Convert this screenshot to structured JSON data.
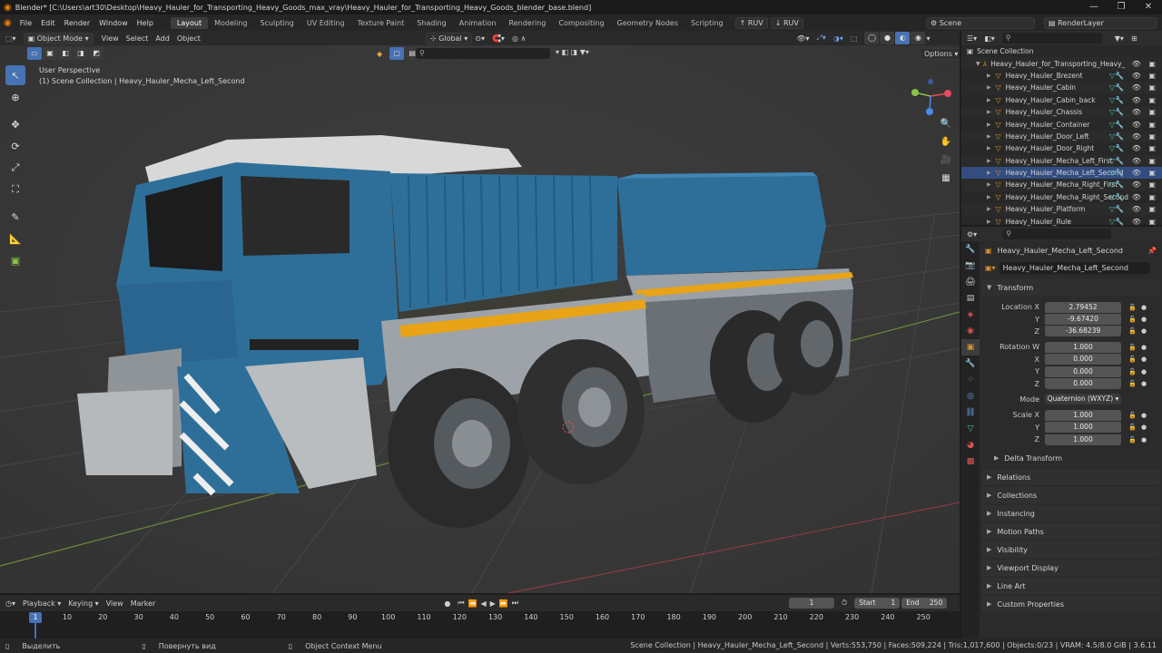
{
  "window": {
    "title": "Blender* [C:\\Users\\art30\\Desktop\\Heavy_Hauler_for_Transporting_Heavy_Goods_max_vray\\Heavy_Hauler_for_Transporting_Heavy_Goods_blender_base.blend]",
    "minimize": "—",
    "maximize": "❐",
    "close": "✕"
  },
  "menu": {
    "items": [
      "File",
      "Edit",
      "Render",
      "Window",
      "Help"
    ],
    "workspaces": [
      "Layout",
      "Modeling",
      "Sculpting",
      "UV Editing",
      "Texture Paint",
      "Shading",
      "Animation",
      "Rendering",
      "Compositing",
      "Geometry Nodes",
      "Scripting"
    ],
    "active_workspace": "Layout",
    "ruv1": "RUV",
    "ruv2": "RUV",
    "scene": "Scene",
    "render_layer": "RenderLayer"
  },
  "viewport": {
    "mode": "Object Mode",
    "menus": [
      "View",
      "Select",
      "Add",
      "Object"
    ],
    "transform_orientation": "Global",
    "options": "Options",
    "perspective_label": "User Perspective",
    "collection_label": "(1) Scene Collection | Heavy_Hauler_Mecha_Left_Second",
    "gizmo": {
      "y_color": "#8bc34a",
      "x_color": "#e84a5f",
      "z_color": "#4a8ae8"
    }
  },
  "outliner": {
    "root": "Scene Collection",
    "collection": "Heavy_Hauler_for_Transporting_Heavy_",
    "items": [
      "Heavy_Hauler_Brezent",
      "Heavy_Hauler_Cabin",
      "Heavy_Hauler_Cabin_back",
      "Heavy_Hauler_Chassis",
      "Heavy_Hauler_Container",
      "Heavy_Hauler_Door_Left",
      "Heavy_Hauler_Door_Right",
      "Heavy_Hauler_Mecha_Left_First",
      "Heavy_Hauler_Mecha_Left_Second",
      "Heavy_Hauler_Mecha_Right_First",
      "Heavy_Hauler_Mecha_Right_Second",
      "Heavy_Hauler_Platform",
      "Heavy_Hauler_Rule"
    ],
    "selected_index": 8
  },
  "properties": {
    "object_name": "Heavy_Hauler_Mecha_Left_Second",
    "object_field": "Heavy_Hauler_Mecha_Left_Second",
    "transform": {
      "title": "Transform",
      "location_label": "Location X",
      "location": {
        "x": "2.79452",
        "y": "-9.67420",
        "z": "-36.68239"
      },
      "rotation_label": "Rotation W",
      "rotation": {
        "w": "1.000",
        "x": "0.000",
        "y": "0.000",
        "z": "0.000"
      },
      "mode_label": "Mode",
      "mode": "Quaternion (WXYZ)",
      "scale_label": "Scale X",
      "scale": {
        "x": "1.000",
        "y": "1.000",
        "z": "1.000"
      },
      "y_label": "Y",
      "z_label": "Z",
      "x_label": "X",
      "delta": "Delta Transform"
    },
    "panels": [
      "Relations",
      "Collections",
      "Instancing",
      "Motion Paths",
      "Visibility",
      "Viewport Display",
      "Line Art",
      "Custom Properties"
    ]
  },
  "timeline": {
    "menus": [
      "Playback",
      "Keying",
      "View",
      "Marker"
    ],
    "current_frame": "1",
    "start_label": "Start",
    "start": "1",
    "end_label": "End",
    "end": "250",
    "ruler": [
      "10",
      "20",
      "30",
      "40",
      "50",
      "60",
      "70",
      "80",
      "90",
      "100",
      "110",
      "120",
      "130",
      "140",
      "150",
      "160",
      "170",
      "180",
      "190",
      "200",
      "210",
      "220",
      "230",
      "240",
      "250"
    ],
    "ruler_current": "1"
  },
  "status": {
    "select": "Выделить",
    "rotate": "Повернуть вид",
    "context": "Object Context Menu",
    "stats": "Scene Collection | Heavy_Hauler_Mecha_Left_Second | Verts:553,750 | Faces:509,224 | Tris:1,017,600 | Objects:0/23 | VRAM: 4.5/8.0 GiB | 3.6.11"
  },
  "colors": {
    "accent": "#4772b3",
    "truck_blue": "#2e6f99",
    "stripe_yellow": "#e8a317",
    "object_orange": "#e0902c"
  }
}
